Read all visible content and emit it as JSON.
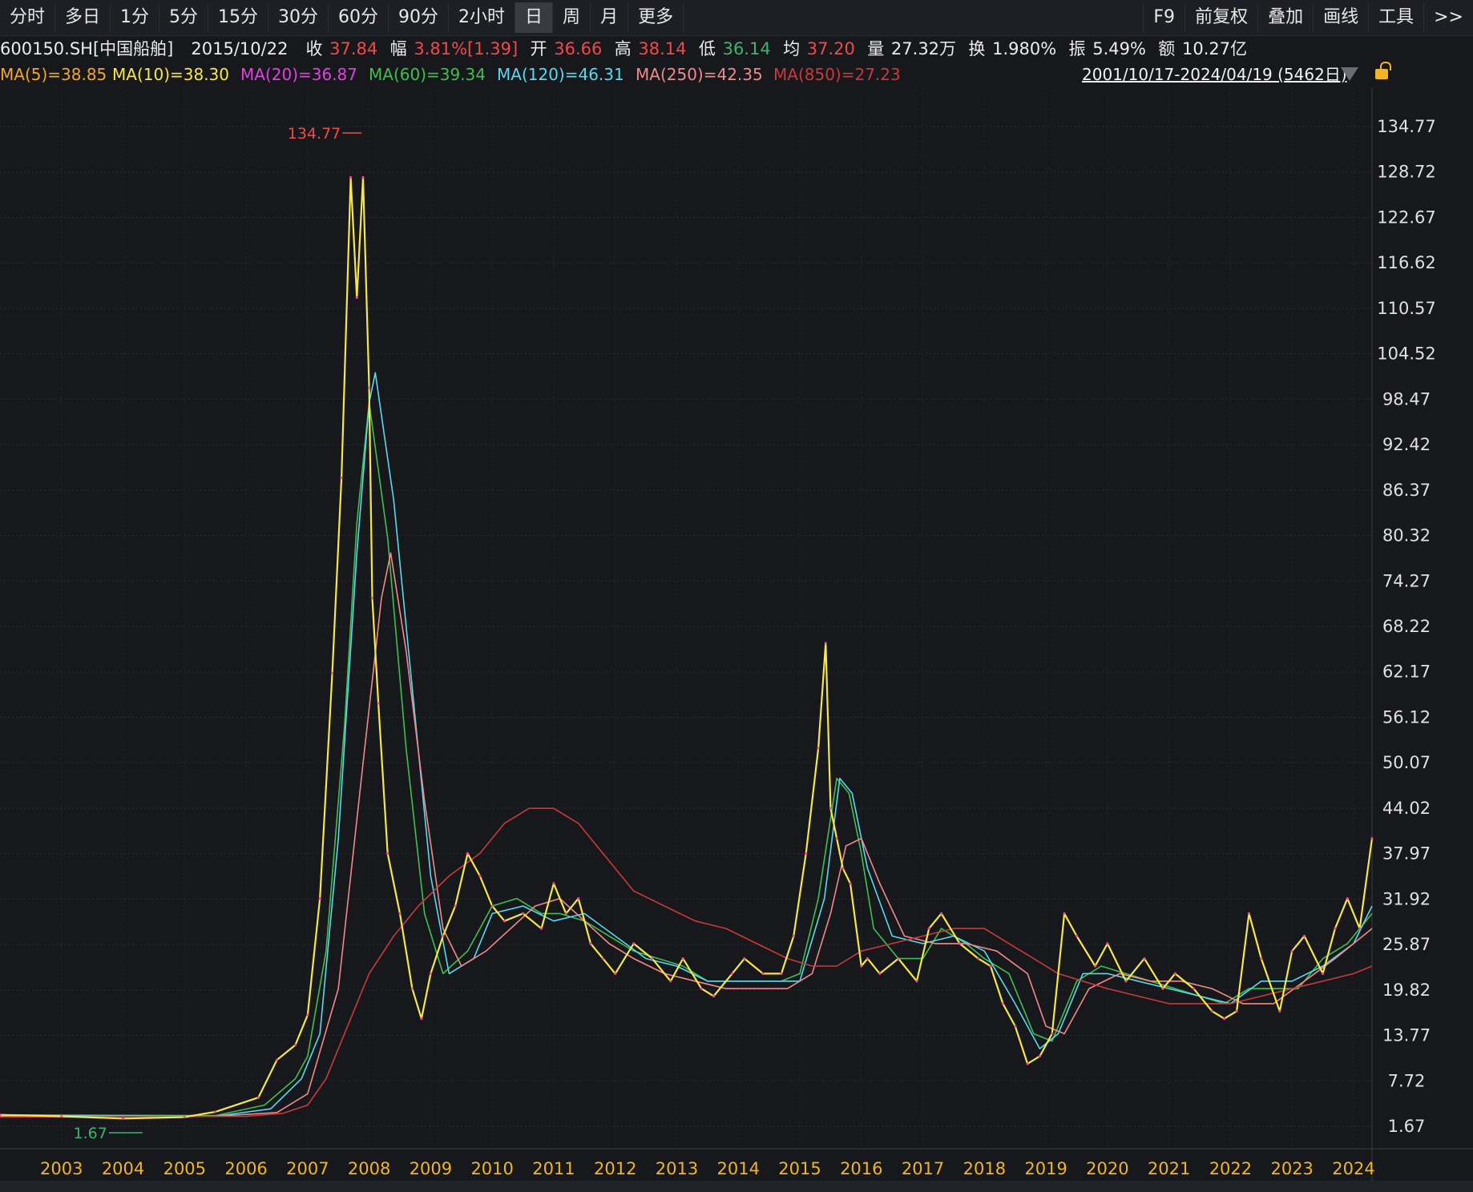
{
  "toolbar": {
    "left": [
      "分时",
      "多日",
      "1分",
      "5分",
      "15分",
      "30分",
      "60分",
      "90分",
      "2小时",
      "日",
      "周",
      "月",
      "更多"
    ],
    "active": "日",
    "right": [
      "F9",
      "前复权",
      "叠加",
      "画线",
      "工具",
      ">>"
    ]
  },
  "info": {
    "code": "600150.SH[中国船舶]",
    "date": "2015/10/22",
    "close_label": "收",
    "close": "37.84",
    "change_label": "幅",
    "change": "3.81%[1.39]",
    "open_label": "开",
    "open": "36.66",
    "high_label": "高",
    "high": "38.14",
    "low_label": "低",
    "low": "36.14",
    "avg_label": "均",
    "avg": "37.20",
    "vol_label": "量",
    "vol": "27.32万",
    "turnover_label": "换",
    "turnover": "1.980%",
    "amp_label": "振",
    "amp": "5.49%",
    "amount_label": "额",
    "amount": "10.27亿"
  },
  "ma": [
    {
      "text": "MA(5)=38.85",
      "color": "#f5a623"
    },
    {
      "text": "MA(10)=38.30",
      "color": "#f7e64a"
    },
    {
      "text": "MA(20)=36.87",
      "color": "#e040e0"
    },
    {
      "text": "MA(60)=39.34",
      "color": "#3fbf4f"
    },
    {
      "text": "MA(120)=46.31",
      "color": "#5ad8f0"
    },
    {
      "text": "MA(250)=42.35",
      "color": "#f08a8a"
    },
    {
      "text": "MA(850)=27.23",
      "color": "#c83a3a"
    }
  ],
  "range_text": "2001/10/17-2024/04/19 (5462日)",
  "chart_data": {
    "type": "line",
    "title": "",
    "xlabel": "",
    "ylabel": "",
    "y_ticks": [
      134.77,
      128.72,
      122.67,
      116.62,
      110.57,
      104.52,
      98.47,
      92.42,
      86.37,
      80.32,
      74.27,
      68.22,
      62.17,
      56.12,
      50.07,
      44.02,
      37.97,
      31.92,
      25.87,
      19.82,
      13.77,
      7.72,
      1.67
    ],
    "ylim": [
      1.67,
      134.77
    ],
    "x_ticks": [
      "2003",
      "2004",
      "2005",
      "2006",
      "2007",
      "2008",
      "2009",
      "2010",
      "2011",
      "2012",
      "2013",
      "2014",
      "2015",
      "2016",
      "2017",
      "2018",
      "2019",
      "2020",
      "2021",
      "2022",
      "2023",
      "2024"
    ],
    "xlim": [
      2002.0,
      2024.3
    ],
    "annotations": [
      {
        "text": "134.77",
        "x": 2007.8,
        "y": 134.77,
        "color": "#ef4a4a"
      },
      {
        "text": "1.67",
        "x": 2003.9,
        "y": 1.67,
        "color": "#3fb36b"
      }
    ],
    "grid": true,
    "series": [
      {
        "key": "price",
        "color": "#f7e64a",
        "x": [
          2002.0,
          2003.0,
          2004.0,
          2005.0,
          2005.5,
          2006.2,
          2006.5,
          2006.8,
          2007.0,
          2007.2,
          2007.4,
          2007.55,
          2007.7,
          2007.8,
          2007.9,
          2008.0,
          2008.05,
          2008.15,
          2008.3,
          2008.5,
          2008.7,
          2008.85,
          2009.0,
          2009.2,
          2009.4,
          2009.6,
          2009.8,
          2010.0,
          2010.2,
          2010.5,
          2010.8,
          2011.0,
          2011.2,
          2011.4,
          2011.6,
          2011.8,
          2012.0,
          2012.3,
          2012.6,
          2012.9,
          2013.1,
          2013.4,
          2013.6,
          2013.9,
          2014.1,
          2014.4,
          2014.7,
          2014.9,
          2015.1,
          2015.3,
          2015.42,
          2015.5,
          2015.6,
          2015.7,
          2015.82,
          2016.0,
          2016.1,
          2016.3,
          2016.6,
          2016.9,
          2017.1,
          2017.3,
          2017.6,
          2017.9,
          2018.1,
          2018.3,
          2018.5,
          2018.7,
          2018.9,
          2019.1,
          2019.3,
          2019.5,
          2019.8,
          2020.0,
          2020.3,
          2020.6,
          2020.9,
          2021.1,
          2021.4,
          2021.7,
          2021.9,
          2022.1,
          2022.3,
          2022.5,
          2022.8,
          2023.0,
          2023.2,
          2023.5,
          2023.7,
          2023.9,
          2024.1,
          2024.3
        ],
        "y": [
          3.2,
          3.0,
          2.7,
          2.9,
          3.6,
          5.5,
          10.5,
          12.5,
          16.5,
          32,
          62,
          88,
          128,
          112,
          128,
          100,
          72,
          58,
          38,
          30,
          20,
          16,
          22,
          27,
          31,
          38,
          35,
          31,
          29,
          30,
          28,
          34,
          30,
          32,
          26,
          24,
          22,
          26,
          24,
          21,
          24,
          20,
          19,
          22,
          24,
          22,
          22,
          27,
          38,
          52,
          66,
          44,
          40,
          36,
          34,
          23,
          24,
          22,
          24,
          21,
          28,
          30,
          26,
          24,
          23,
          18,
          15,
          10,
          11,
          14,
          30,
          27,
          23,
          26,
          21,
          24,
          20,
          22,
          20,
          17,
          16,
          17,
          30,
          24,
          17,
          25,
          27,
          22,
          28,
          32,
          28,
          40
        ]
      },
      {
        "key": "ma60",
        "color": "#3fbf4f",
        "x": [
          2002.0,
          2005.5,
          2006.3,
          2006.8,
          2007.0,
          2007.3,
          2007.6,
          2007.8,
          2008.0,
          2008.3,
          2008.6,
          2008.9,
          2009.2,
          2009.6,
          2010.0,
          2010.4,
          2010.8,
          2011.1,
          2011.5,
          2011.9,
          2012.3,
          2012.7,
          2013.1,
          2013.5,
          2013.9,
          2014.3,
          2014.7,
          2015.0,
          2015.3,
          2015.6,
          2015.8,
          2016.0,
          2016.2,
          2016.6,
          2017.0,
          2017.3,
          2017.7,
          2018.0,
          2018.4,
          2018.8,
          2019.1,
          2019.5,
          2019.9,
          2020.3,
          2020.7,
          2021.1,
          2021.5,
          2021.9,
          2022.3,
          2022.7,
          2023.1,
          2023.5,
          2023.9,
          2024.3
        ],
        "y": [
          3.2,
          3.1,
          4.5,
          8,
          11,
          25,
          55,
          82,
          98,
          80,
          52,
          30,
          22,
          25,
          31,
          32,
          30,
          30,
          29,
          27,
          25,
          24,
          23,
          21,
          21,
          21,
          21,
          22,
          32,
          48,
          46,
          38,
          28,
          24,
          24,
          28,
          26,
          24,
          22,
          14,
          13,
          21,
          23,
          22,
          21,
          20,
          19,
          18,
          20,
          20,
          20,
          24,
          26,
          30
        ]
      },
      {
        "key": "ma120",
        "color": "#5ad8f0",
        "x": [
          2002.0,
          2005.5,
          2006.4,
          2006.9,
          2007.2,
          2007.5,
          2007.8,
          2008.0,
          2008.1,
          2008.4,
          2008.7,
          2009.0,
          2009.3,
          2009.7,
          2010.0,
          2010.5,
          2011.0,
          2011.5,
          2012.0,
          2012.5,
          2013.0,
          2013.5,
          2014.0,
          2014.5,
          2015.0,
          2015.4,
          2015.65,
          2015.85,
          2016.1,
          2016.5,
          2017.0,
          2017.5,
          2018.0,
          2018.5,
          2018.9,
          2019.2,
          2019.6,
          2020.0,
          2020.5,
          2021.0,
          2021.5,
          2022.0,
          2022.5,
          2023.0,
          2023.5,
          2024.0,
          2024.3
        ],
        "y": [
          3.1,
          3.0,
          4,
          8,
          14,
          40,
          78,
          98,
          102,
          85,
          60,
          35,
          22,
          24,
          30,
          31,
          29,
          30,
          27,
          24,
          23,
          21,
          21,
          21,
          21,
          32,
          48,
          46,
          36,
          27,
          26,
          27,
          25,
          18,
          12,
          14,
          22,
          22,
          21,
          20,
          19,
          18,
          21,
          21,
          23,
          26,
          31
        ]
      },
      {
        "key": "ma250",
        "color": "#f08a8a",
        "x": [
          2002.0,
          2005.5,
          2006.5,
          2007.0,
          2007.5,
          2007.9,
          2008.2,
          2008.35,
          2008.6,
          2008.9,
          2009.2,
          2009.5,
          2009.9,
          2010.3,
          2010.7,
          2011.1,
          2011.5,
          2011.9,
          2012.3,
          2012.8,
          2013.3,
          2013.8,
          2014.3,
          2014.8,
          2015.2,
          2015.5,
          2015.75,
          2016.0,
          2016.3,
          2016.7,
          2017.2,
          2017.7,
          2018.2,
          2018.7,
          2019.0,
          2019.3,
          2019.7,
          2020.2,
          2020.7,
          2021.2,
          2021.7,
          2022.2,
          2022.7,
          2023.2,
          2023.7,
          2024.3
        ],
        "y": [
          3.0,
          3.0,
          3.5,
          6,
          20,
          50,
          72,
          78,
          65,
          45,
          28,
          23,
          25,
          28,
          31,
          32,
          29,
          26,
          24,
          22,
          21,
          20,
          20,
          20,
          22,
          30,
          39,
          40,
          34,
          27,
          26,
          26,
          25,
          22,
          15,
          14,
          20,
          22,
          21,
          21,
          20,
          18,
          18,
          21,
          24,
          28
        ]
      },
      {
        "key": "ma850",
        "color": "#c83a3a",
        "x": [
          2002.0,
          2006.0,
          2006.6,
          2007.0,
          2007.3,
          2007.6,
          2008.0,
          2008.4,
          2008.8,
          2009.3,
          2009.8,
          2010.2,
          2010.6,
          2011.0,
          2011.4,
          2011.8,
          2012.3,
          2012.8,
          2013.3,
          2013.8,
          2014.3,
          2014.8,
          2015.2,
          2015.6,
          2016.0,
          2016.5,
          2017.0,
          2017.5,
          2018.0,
          2018.4,
          2018.8,
          2019.2,
          2019.6,
          2020.0,
          2020.5,
          2021.0,
          2021.5,
          2022.0,
          2022.5,
          2023.0,
          2023.5,
          2024.0,
          2024.3
        ],
        "y": [
          2.9,
          3.0,
          3.4,
          4.5,
          8,
          14,
          22,
          27,
          31,
          35,
          38,
          42,
          44,
          44,
          42,
          38,
          33,
          31,
          29,
          28,
          26,
          24,
          23,
          23,
          25,
          26,
          27,
          28,
          28,
          26,
          24,
          22,
          21,
          20,
          19,
          18,
          18,
          18,
          19,
          20,
          21,
          22,
          23
        ]
      }
    ]
  }
}
